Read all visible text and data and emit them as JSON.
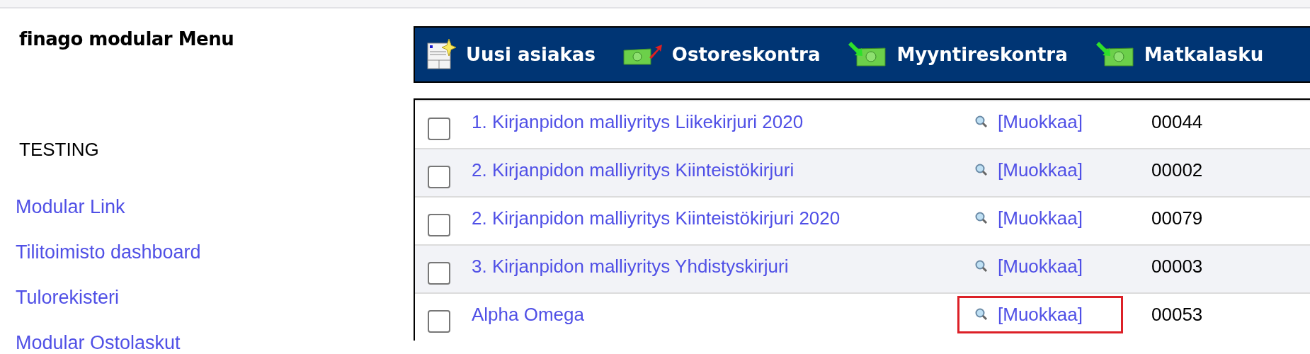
{
  "sidebar": {
    "title": "finago modular Menu",
    "section": "TESTING",
    "links": [
      "Modular Link",
      "Tilitoimisto dashboard",
      "Tulorekisteri",
      "Modular Ostolaskut"
    ]
  },
  "toolbar": {
    "items": [
      {
        "label": "Uusi asiakas",
        "kind": "new"
      },
      {
        "label": "Ostoreskontra",
        "kind": "outgoing"
      },
      {
        "label": "Myyntireskontra",
        "kind": "incoming"
      },
      {
        "label": "Matkalasku",
        "kind": "incoming"
      }
    ]
  },
  "table": {
    "rows": [
      {
        "checked": false,
        "name": "1. Kirjanpidon malliyritys Liikekirjuri 2020",
        "edit": "[Muokkaa]",
        "number": "00044",
        "highlighted": false
      },
      {
        "checked": false,
        "name": "2. Kirjanpidon malliyritys Kiinteistökirjuri",
        "edit": "[Muokkaa]",
        "number": "00002",
        "highlighted": false
      },
      {
        "checked": false,
        "name": "2. Kirjanpidon malliyritys Kiinteistökirjuri 2020",
        "edit": "[Muokkaa]",
        "number": "00079",
        "highlighted": false
      },
      {
        "checked": false,
        "name": "3. Kirjanpidon malliyritys Yhdistyskirjuri",
        "edit": "[Muokkaa]",
        "number": "00003",
        "highlighted": false
      },
      {
        "checked": false,
        "name": "Alpha Omega",
        "edit": "[Muokkaa]",
        "number": "00053",
        "highlighted": true
      }
    ]
  }
}
